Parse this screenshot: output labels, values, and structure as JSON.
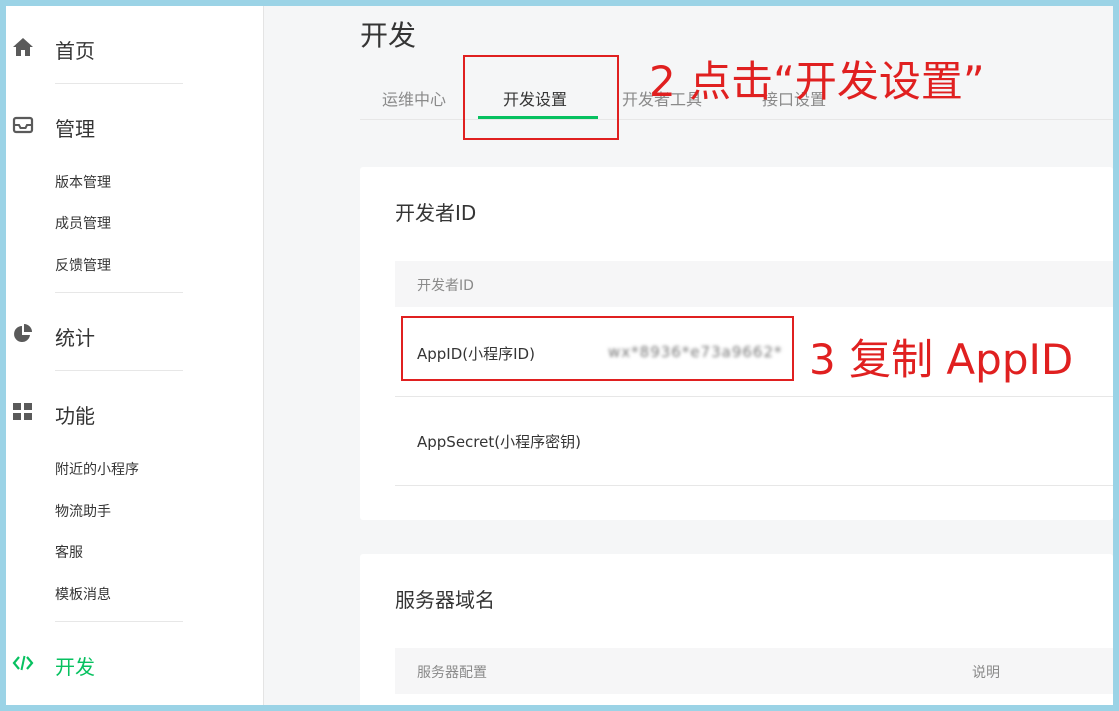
{
  "sidebar": {
    "home": "首页",
    "manage": "管理",
    "manage_items": [
      "版本管理",
      "成员管理",
      "反馈管理"
    ],
    "stats": "统计",
    "features": "功能",
    "feature_items": [
      "附近的小程序",
      "物流助手",
      "客服",
      "模板消息"
    ],
    "dev": "开发",
    "active_item": "开发",
    "active_color": "#07c160"
  },
  "page": {
    "title": "开发",
    "tabs": [
      "运维中心",
      "开发设置",
      "开发者工具",
      "接口设置"
    ],
    "selected_tab": "开发设置"
  },
  "developer_card": {
    "title": "开发者ID",
    "header": "开发者ID",
    "rows": [
      {
        "key": "AppID(小程序ID)",
        "value": "wx*8936*e73a9662*"
      },
      {
        "key": "AppSecret(小程序密钥)",
        "value": ""
      }
    ]
  },
  "server_card": {
    "title": "服务器域名",
    "header_col1": "服务器配置",
    "header_col2": "说明"
  },
  "annotations": {
    "step2": "2 点击“开发设置”",
    "step3": "3 复制 AppID",
    "color": "#e02020"
  }
}
